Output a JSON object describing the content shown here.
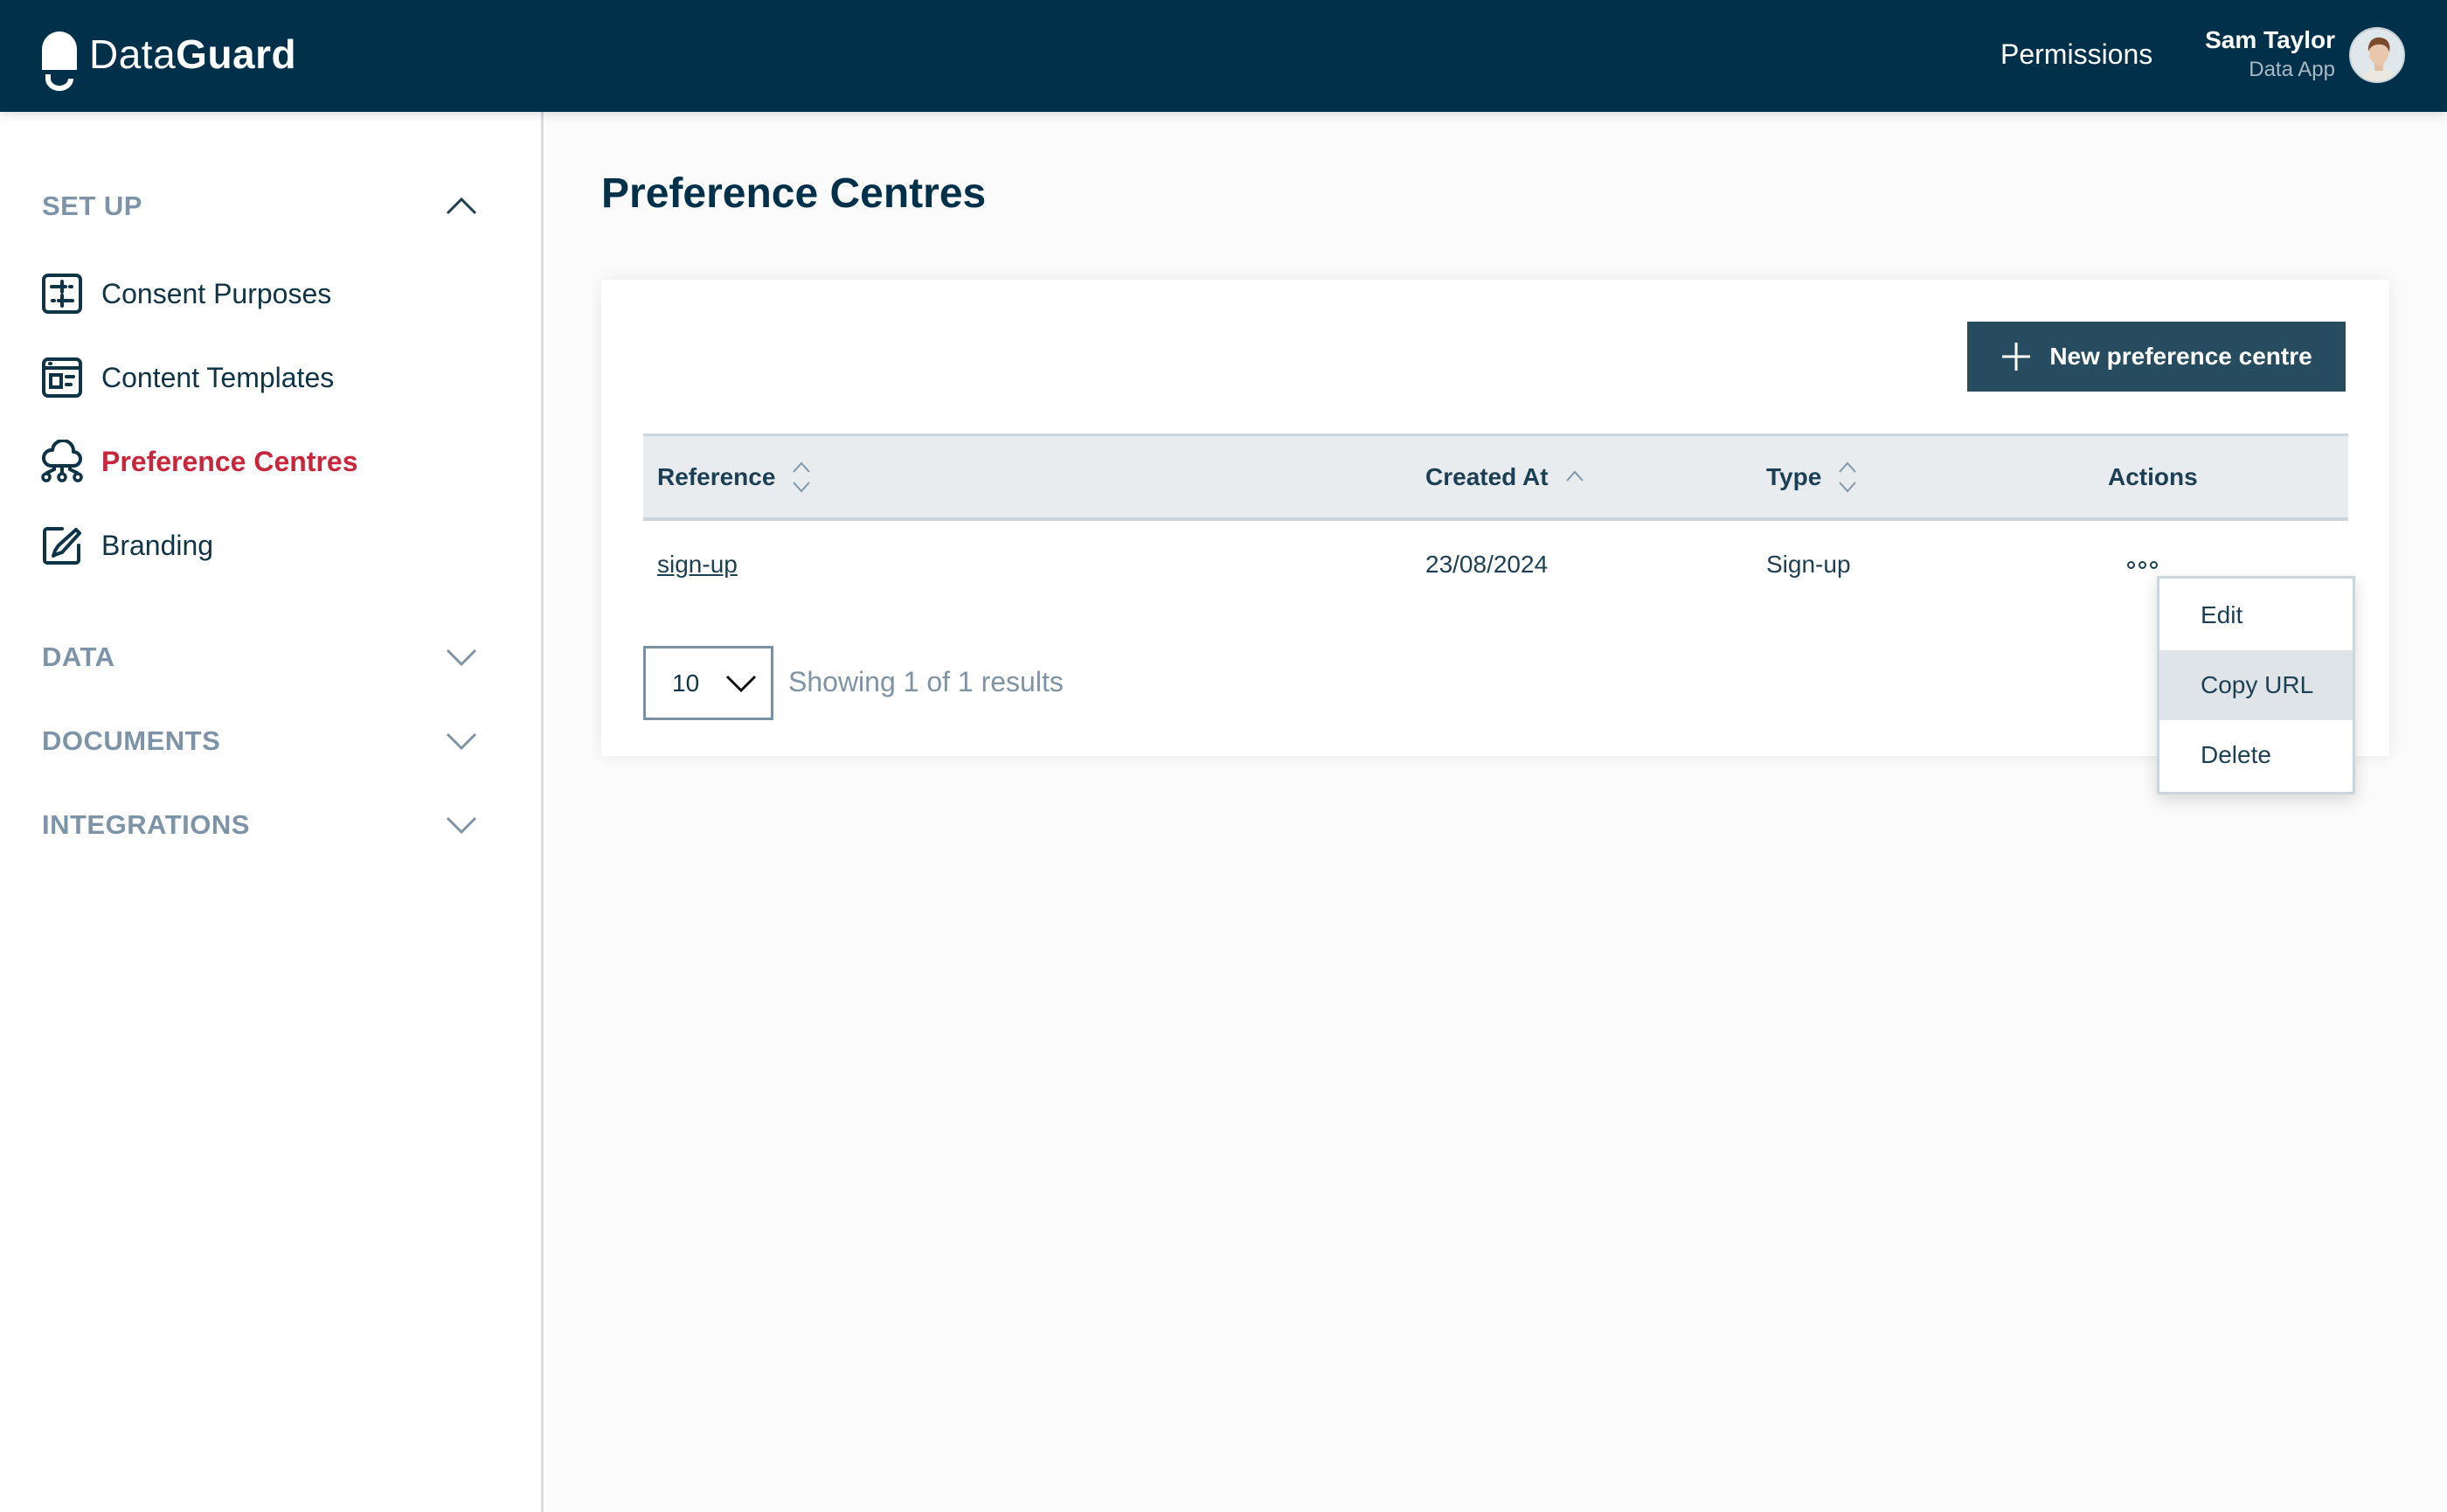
{
  "header": {
    "brand_light": "Data",
    "brand_bold": "Guard",
    "nav_permissions": "Permissions",
    "user_name": "Sam Taylor",
    "user_role": "Data App",
    "bg_color": "#01304a"
  },
  "sidebar": {
    "sections": [
      {
        "title": "SET UP",
        "expanded": true,
        "icon": "chevron-up-icon"
      },
      {
        "title": "DATA",
        "expanded": false,
        "icon": "chevron-down-icon"
      },
      {
        "title": "DOCUMENTS",
        "expanded": false,
        "icon": "chevron-down-icon"
      },
      {
        "title": "INTEGRATIONS",
        "expanded": false,
        "icon": "chevron-down-icon"
      }
    ],
    "items": [
      {
        "label": "Consent Purposes",
        "icon": "sliders-icon",
        "active": false
      },
      {
        "label": "Content Templates",
        "icon": "template-icon",
        "active": false
      },
      {
        "label": "Preference Centres",
        "icon": "cloud-network-icon",
        "active": true
      },
      {
        "label": "Branding",
        "icon": "brush-edit-icon",
        "active": false
      }
    ],
    "active_color": "#c8263a"
  },
  "main": {
    "title": "Preference Centres",
    "new_button_label": "New preference centre",
    "table": {
      "columns": [
        {
          "label": "Reference",
          "sort": "none"
        },
        {
          "label": "Created At",
          "sort": "ascending"
        },
        {
          "label": "Type",
          "sort": "none"
        },
        {
          "label": "Actions",
          "sort": null
        }
      ],
      "rows": [
        {
          "reference": "sign-up",
          "created_at": "23/08/2024",
          "type": "Sign-up"
        }
      ]
    },
    "pagination": {
      "page_size": "10",
      "summary": "Showing 1 of 1 results"
    },
    "actions_menu": {
      "items": [
        {
          "label": "Edit",
          "hovered": false
        },
        {
          "label": "Copy URL",
          "hovered": true
        },
        {
          "label": "Delete",
          "hovered": false
        }
      ]
    }
  }
}
